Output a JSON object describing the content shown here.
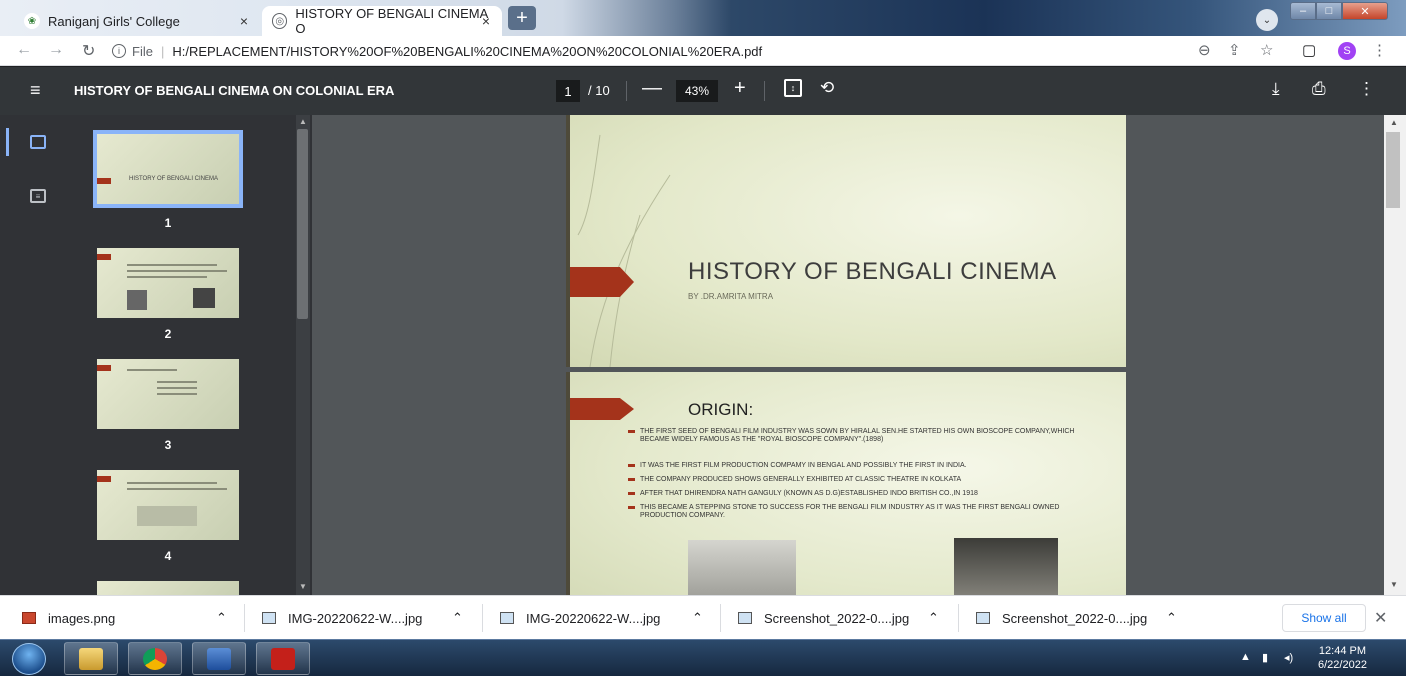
{
  "browser": {
    "tabs": [
      {
        "title": "Raniganj Girls' College",
        "close": "×"
      },
      {
        "title": "HISTORY OF BENGALI CINEMA O",
        "close": "×"
      }
    ],
    "new_tab": "+",
    "window_controls": {
      "minimize": "–",
      "maximize": "□",
      "close": "✕"
    },
    "address": {
      "scheme_label": "File",
      "url": "H:/REPLACEMENT/HISTORY%20OF%20BENGALI%20CINEMA%20ON%20COLONIAL%20ERA.pdf"
    },
    "profile_initial": "S"
  },
  "pdf_toolbar": {
    "title": "HISTORY OF BENGALI CINEMA ON COLONIAL ERA",
    "current_page": "1",
    "total_pages": "/ 10",
    "zoom": "43%",
    "zoom_out": "—",
    "zoom_in": "+"
  },
  "thumbnails": {
    "pages": [
      "1",
      "2",
      "3",
      "4"
    ],
    "thumb1_text": "HISTORY OF BENGALI CINEMA"
  },
  "slides": {
    "slide1": {
      "title": "HISTORY OF BENGALI CINEMA",
      "subtitle": "BY .DR.AMRITA MITRA"
    },
    "slide2": {
      "title": "ORIGIN:",
      "bullets": [
        "THE FIRST SEED OF BENGALI FILM INDUSTRY WAS SOWN BY HIRALAL SEN.HE STARTED HIS OWN BIOSCOPE COMPANY,WHICH BECAME WIDELY FAMOUS AS THE \"ROYAL BIOSCOPE COMPANY\".(1898)",
        "IT WAS THE FIRST FILM PRODUCTION COMPAMY IN BENGAL AND POSSIBLY THE FIRST IN INDIA.",
        "THE COMPANY PRODUCED SHOWS GENERALLY EXHIBITED AT CLASSIC THEATRE IN KOLKATA",
        "AFTER THAT DHIRENDRA NATH GANGULY (KNOWN AS D.G)ESTABLISHED INDO BRITISH CO.,IN 1918",
        "THIS BECAME A STEPPING STONE TO SUCCESS FOR THE BENGALI FILM INDUSTRY AS IT WAS THE FIRST BENGALI OWNED PRODUCTION COMPANY."
      ]
    }
  },
  "downloads": {
    "items": [
      "images.png",
      "IMG-20220622-W....jpg",
      "IMG-20220622-W....jpg",
      "Screenshot_2022-0....jpg",
      "Screenshot_2022-0....jpg"
    ],
    "show_all": "Show all",
    "close": "✕"
  },
  "taskbar": {
    "time": "12:44 PM",
    "date": "6/22/2022"
  },
  "colors": {
    "accent": "#8ab4f8",
    "slide_arrow": "#a4331b",
    "pdf_toolbar": "#323639",
    "profile": "#a142f4"
  },
  "icons": [
    "globe-icon",
    "back-icon",
    "forward-icon",
    "reload-icon",
    "info-icon",
    "zoom-icon",
    "share-icon",
    "star-icon",
    "sidebar-icon",
    "menu-icon",
    "fit-page-icon",
    "rotate-icon",
    "download-icon",
    "print-icon",
    "more-icon",
    "thumbnail-view-icon",
    "outline-view-icon",
    "chevron-up-icon",
    "file-icon",
    "start-orb-icon",
    "explorer-icon",
    "chrome-icon",
    "word-icon",
    "acrobat-icon",
    "volume-icon",
    "network-icon"
  ]
}
